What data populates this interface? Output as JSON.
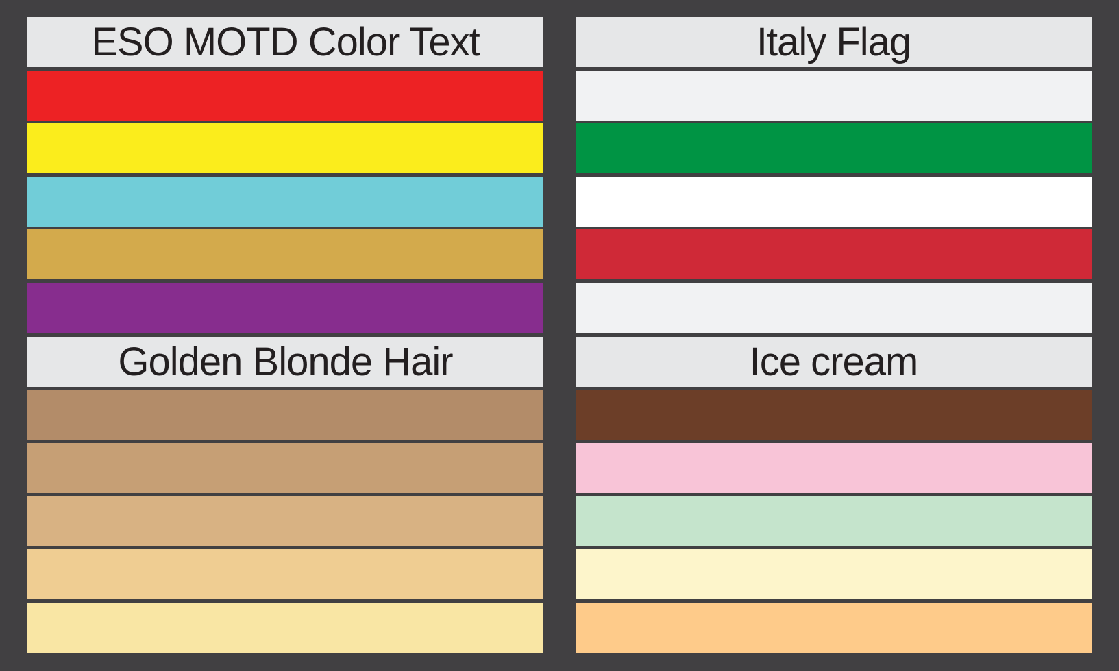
{
  "palettes": [
    {
      "title": "ESO MOTD Color Text",
      "colors": [
        "#ed2224",
        "#fbed1c",
        "#71cdd8",
        "#d3aa4c",
        "#872d8e"
      ]
    },
    {
      "title": "Italy Flag",
      "colors": [
        "#f1f2f3",
        "#009444",
        "#ffffff",
        "#cf2937",
        "#f1f2f3"
      ]
    },
    {
      "title": "Golden Blonde Hair",
      "colors": [
        "#b38c69",
        "#c69f75",
        "#d8b283",
        "#efcd92",
        "#f9e6a4"
      ]
    },
    {
      "title": "Ice cream",
      "colors": [
        "#6c3e28",
        "#f8c4d7",
        "#c5e4cc",
        "#fdf5cb",
        "#fecb8a"
      ]
    }
  ]
}
